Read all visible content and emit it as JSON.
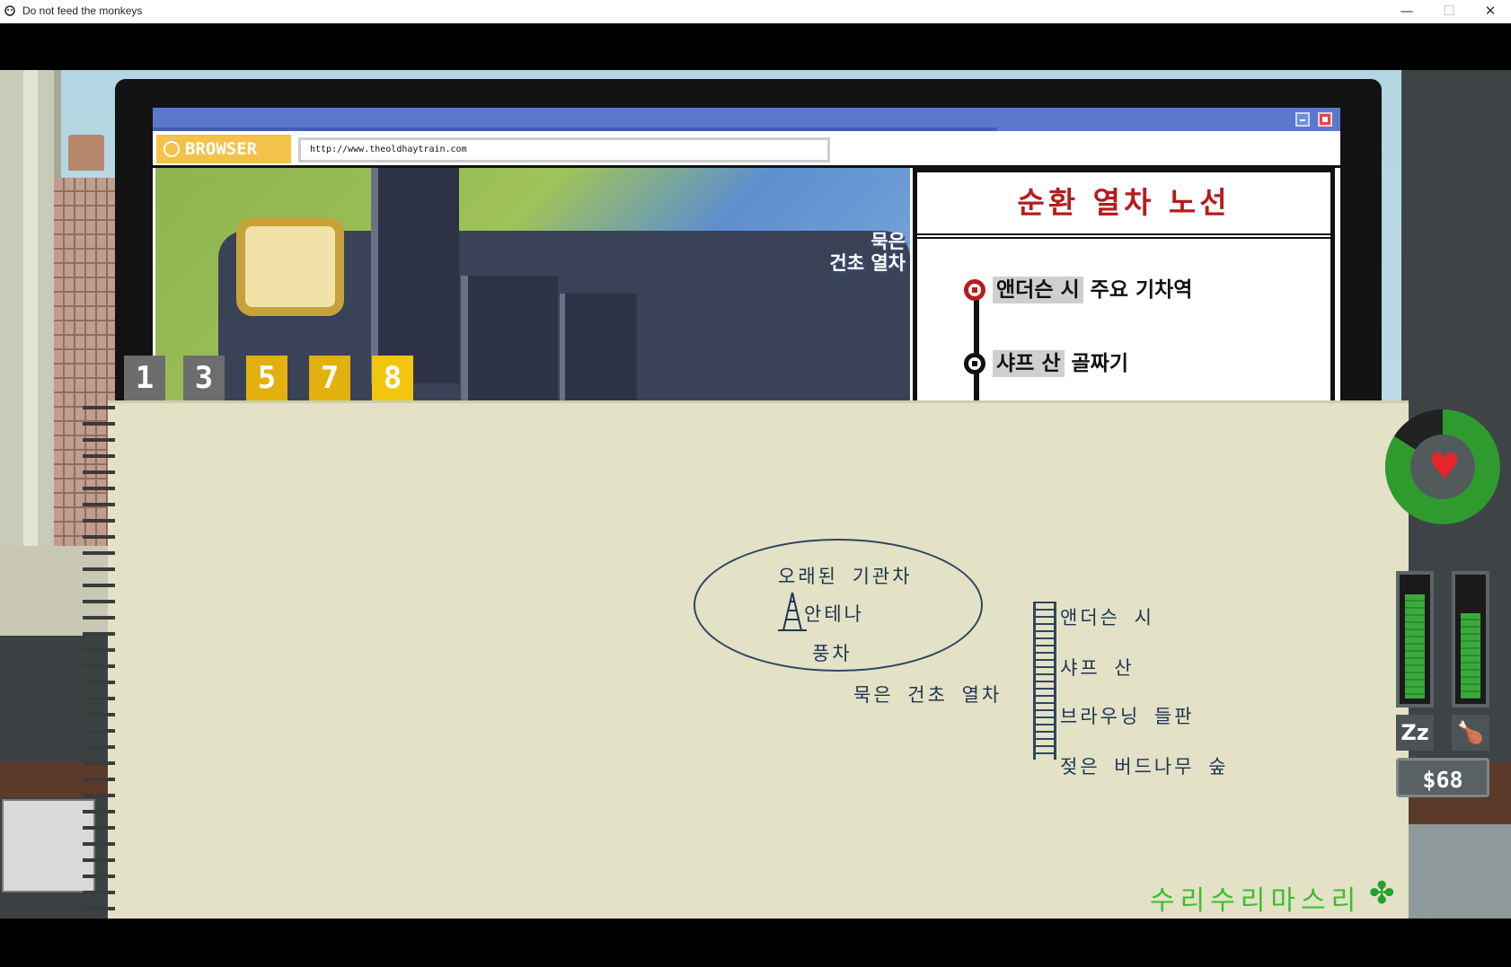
{
  "window": {
    "title": "Do not feed the monkeys",
    "minimize_glyph": "—",
    "maximize_glyph": "☐",
    "close_glyph": "✕"
  },
  "browser": {
    "logo": "BROWSER",
    "url": "http://www.theoldhaytrain.com",
    "image_caption_line1": "묵은",
    "image_caption_line2": "건초 열차",
    "route_panel": {
      "title": "순환 열차 노선",
      "stops": [
        {
          "name": "앤더슨 시",
          "desc": "주요 기차역"
        },
        {
          "name": "샤프 산",
          "desc": "골짜기"
        }
      ]
    }
  },
  "notebook": {
    "tabs": [
      "1",
      "3",
      "5",
      "7",
      "8"
    ],
    "active_tab": "8",
    "notes": {
      "old_locomotive": "오래된 기관차",
      "antenna": "안테나",
      "windmill": "풍차",
      "hay_train": "묵은 건초 열차",
      "stops": [
        "앤더슨 시",
        "샤프 산",
        "브라우닝 들판",
        "젖은 버드나무 숲"
      ]
    },
    "watermark": "수리수리마스리"
  },
  "hud": {
    "health_fraction": 0.84,
    "sleep_fraction": 0.85,
    "food_fraction": 0.7,
    "sleep_icon_glyph": "Zz",
    "food_icon_glyph": "🍗",
    "heart_glyph": "♥",
    "money": "$68"
  },
  "colors": {
    "accent_red": "#b51d1d",
    "status_green": "#3aaa3a",
    "browser_blue": "#5a78cc",
    "tab_yellow": "#e3b10d",
    "watermark_green": "#3dbe2d"
  }
}
